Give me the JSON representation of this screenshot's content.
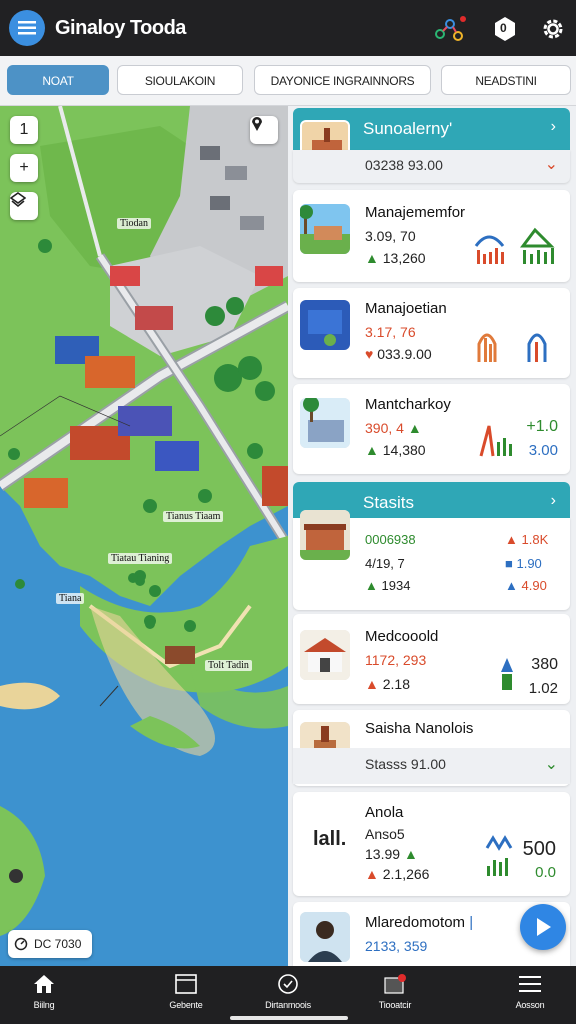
{
  "app": {
    "title": "Ginaloy Tooda"
  },
  "topbar": {
    "menu_icon": "hamburger-icon",
    "icons": [
      "network-icon",
      "notification-badge-icon",
      "settings-gear-icon"
    ],
    "notification_count": "0"
  },
  "tabs": [
    {
      "label": "NOAT",
      "active": true
    },
    {
      "label": "SIOULAKOIN",
      "active": false
    },
    {
      "label": "DAYONICE INGRAINNORS",
      "active": false
    },
    {
      "label": "NEADSTINI",
      "active": false
    }
  ],
  "map": {
    "controls": [
      "1",
      "+"
    ],
    "labels": [
      "Tiodan",
      "Tianus Tiaam",
      "Tiatau Tianing",
      "Tiana",
      "Tolt Tadin"
    ],
    "scale_text": "DC 7030"
  },
  "panel": {
    "section1": {
      "title": "Sunoalerny'"
    },
    "summary1": {
      "value": "03238 93.00"
    },
    "cards": [
      {
        "title": "Manajememfor",
        "v1": "3.09, 70",
        "v2": "13,260"
      },
      {
        "title": "Manajoetian",
        "v1": "3.17, 76",
        "v2": "033.9.00"
      },
      {
        "title": "Mantcharkoy",
        "v1": "390, 4",
        "v2": "14,380",
        "r1": "+1.0",
        "r2": "3.00"
      }
    ],
    "section2": {
      "title": "Stasits"
    },
    "stats_card": {
      "l1": "0006938",
      "l2": "4/19, 7",
      "l3": "1934",
      "r1": "1.8K",
      "r2": "1.90",
      "r3": "4.90"
    },
    "card4": {
      "title": "Medcooold",
      "v1": "1172, 293",
      "v2": "2.18",
      "r1": "380",
      "r2": "1.02"
    },
    "card5": {
      "title": "Saisha Nanolois",
      "v1": "Stasss 91.00"
    },
    "card6": {
      "title": "Anola",
      "logo": "lall.",
      "v1": "Anso5",
      "v2": "13.99",
      "v3": "2.1,266",
      "r1": "500",
      "r2": "0.0"
    },
    "card7": {
      "title": "Mlaredomotom",
      "v1": "2133, 359"
    }
  },
  "bottom_nav": [
    {
      "label": "Biilng",
      "icon": "home-icon"
    },
    {
      "label": "Gebente",
      "icon": "window-icon"
    },
    {
      "label": "Dirtanmoois",
      "icon": "compass-icon"
    },
    {
      "label": "Tiooatcir",
      "icon": "inbox-icon"
    },
    {
      "label": "Aosson",
      "icon": "menu-lines-icon"
    }
  ],
  "colors": {
    "accent": "#2fa7b6",
    "tab_active": "#4d92c6",
    "water": "#3d92cf",
    "land": "#7cc35a",
    "fab": "#2f86e4"
  }
}
